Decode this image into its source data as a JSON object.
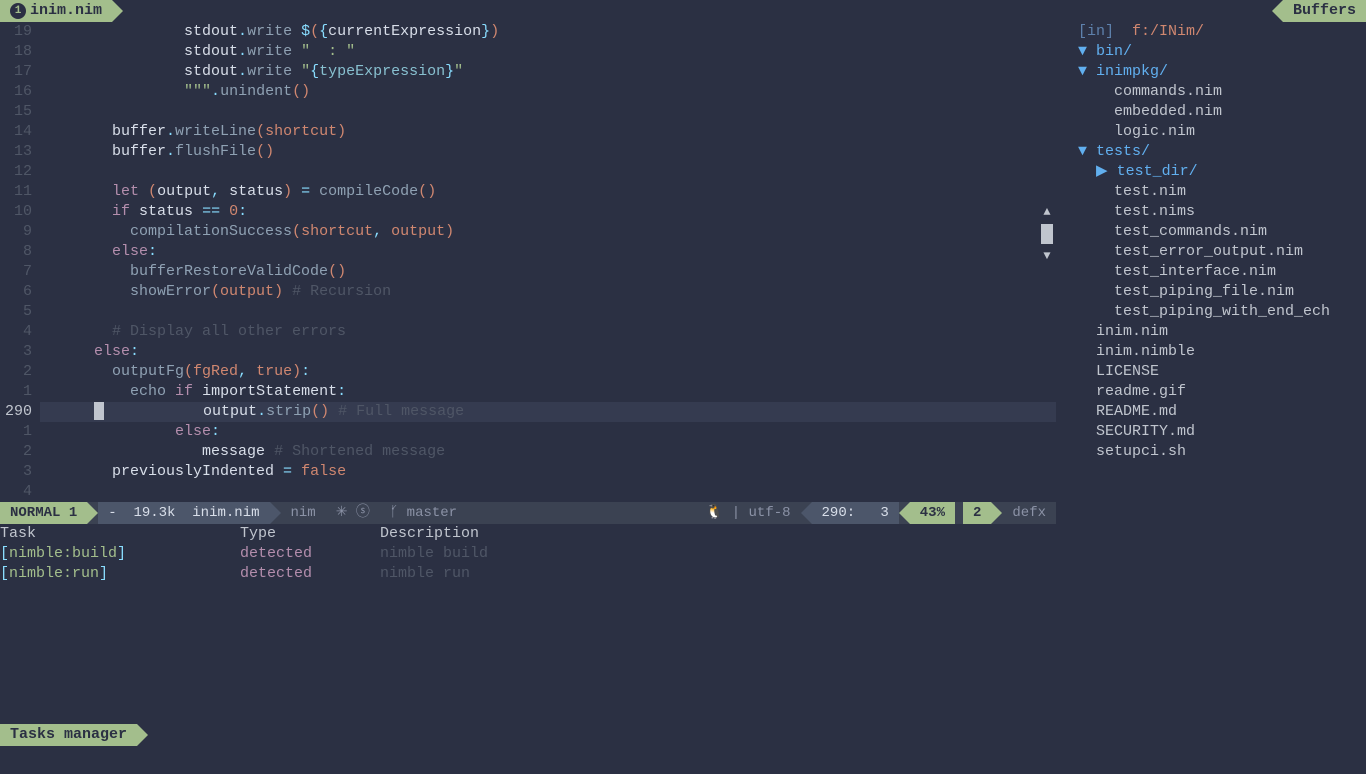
{
  "tabs": {
    "left_num": "1",
    "left_label": "inim.nim",
    "right_label": "Buffers"
  },
  "gutter": [
    "19",
    "18",
    "17",
    "16",
    "15",
    "14",
    "13",
    "12",
    "11",
    "10",
    "9",
    "8",
    "7",
    "6",
    "5",
    "4",
    "3",
    "2",
    "1",
    "290",
    "1",
    "2",
    "3",
    "4"
  ],
  "code": {
    "l19": {
      "pre": "                ",
      "fn1": "stdout",
      "dot": ".",
      "fn2": "write",
      "sp": " ",
      "dollar": "$",
      "lp": "(",
      "lb": "{",
      "id": "currentExpression",
      "rb": "}",
      "rp": ")"
    },
    "l18": {
      "pre": "                ",
      "fn1": "stdout",
      "dot": ".",
      "fn2": "write",
      "sp": " ",
      "str": "\"  : \""
    },
    "l17": {
      "pre": "                ",
      "fn1": "stdout",
      "dot": ".",
      "fn2": "write",
      "sp": " ",
      "q1": "\"",
      "lb": "{",
      "id": "typeExpression",
      "rb": "}",
      "q2": "\""
    },
    "l16": {
      "pre": "                ",
      "tq": "\"\"\"",
      "dot": ".",
      "fn": "unindent",
      "lp": "(",
      "rp": ")"
    },
    "l14": {
      "pre": "        ",
      "id": "buffer",
      "dot": ".",
      "fn": "writeLine",
      "lp": "(",
      "arg": "shortcut",
      "rp": ")"
    },
    "l13": {
      "pre": "        ",
      "id": "buffer",
      "dot": ".",
      "fn": "flushFile",
      "lp": "(",
      "rp": ")"
    },
    "l11": {
      "pre": "        ",
      "let": "let",
      "sp": " ",
      "lp": "(",
      "a": "output",
      "comma": ", ",
      "b": "status",
      "rp": ")",
      "eq": " = ",
      "fn": "compileCode",
      "lp2": "(",
      "rp2": ")"
    },
    "l10": {
      "pre": "        ",
      "if": "if",
      "sp": " ",
      "id": "status",
      "op": " == ",
      "num": "0",
      "colon": ":"
    },
    "l9": {
      "pre": "          ",
      "fn": "compilationSuccess",
      "lp": "(",
      "a": "shortcut",
      "comma": ", ",
      "b": "output",
      "rp": ")"
    },
    "l8": {
      "pre": "        ",
      "else": "else",
      "colon": ":"
    },
    "l7": {
      "pre": "          ",
      "fn": "bufferRestoreValidCode",
      "lp": "(",
      "rp": ")"
    },
    "l6": {
      "pre": "          ",
      "fn": "showError",
      "lp": "(",
      "arg": "output",
      "rp": ")",
      "sp": " ",
      "com": "# Recursion"
    },
    "l4": {
      "pre": "        ",
      "com": "# Display all other errors"
    },
    "l3": {
      "pre": "      ",
      "else": "else",
      "colon": ":"
    },
    "l2": {
      "pre": "        ",
      "fn": "outputFg",
      "lp": "(",
      "a": "fgRed",
      "comma": ", ",
      "b": "true",
      "rp": ")",
      "colon": ":"
    },
    "l1": {
      "pre": "          ",
      "echo": "echo",
      "sp": " ",
      "if": "if",
      "sp2": " ",
      "id": "importStatement",
      "colon": ":"
    },
    "l290": {
      "pre": "                  ",
      "id": "output",
      "dot": ".",
      "fn": "strip",
      "lp": "(",
      "rp": ")",
      "sp": " ",
      "com": "# Full message"
    },
    "p1": {
      "pre": "               ",
      "else": "else",
      "colon": ":"
    },
    "p2": {
      "pre": "                  ",
      "id": "message",
      "sp": " ",
      "com": "# Shortened message"
    },
    "p3": {
      "pre": "        ",
      "id": "previouslyIndented",
      "eq": " = ",
      "val": "false"
    }
  },
  "status": {
    "mode": "NORMAL",
    "win": "1",
    "dash": "-",
    "size": "19.3k",
    "file": "inim.nim",
    "ft": "nim",
    "diag": "✳ ⓢ",
    "branch_icon": "ᚶ",
    "branch": "master",
    "os_icon": "🐧",
    "pipe": "|",
    "enc": "utf-8",
    "line": "290:",
    "col": "3",
    "pct": "43%",
    "win2": "2",
    "buf2": "defx"
  },
  "tasks": {
    "headers": {
      "task": "Task",
      "type": "Type",
      "desc": "Description"
    },
    "rows": [
      {
        "name": "nimble:build",
        "type": "detected",
        "desc": "nimble build"
      },
      {
        "name": "nimble:run",
        "type": "detected",
        "desc": "nimble run"
      }
    ],
    "tab_label": "Tasks manager"
  },
  "tree": {
    "root_in": "[in]",
    "root_path": "f:/INim/",
    "items": [
      {
        "ind": 1,
        "arrow": "▼",
        "name": "bin/",
        "dir": true
      },
      {
        "ind": 1,
        "arrow": "▼",
        "name": "inimpkg/",
        "dir": true
      },
      {
        "ind": 2,
        "arrow": "",
        "name": "commands.nim"
      },
      {
        "ind": 2,
        "arrow": "",
        "name": "embedded.nim"
      },
      {
        "ind": 2,
        "arrow": "",
        "name": "logic.nim"
      },
      {
        "ind": 1,
        "arrow": "▼",
        "name": "tests/",
        "dir": true
      },
      {
        "ind": 2,
        "arrow": "▶",
        "name": "test_dir/",
        "dir": true
      },
      {
        "ind": 2,
        "arrow": "",
        "name": "test.nim"
      },
      {
        "ind": 2,
        "arrow": "",
        "name": "test.nims"
      },
      {
        "ind": 2,
        "arrow": "",
        "name": "test_commands.nim"
      },
      {
        "ind": 2,
        "arrow": "",
        "name": "test_error_output.nim"
      },
      {
        "ind": 2,
        "arrow": "",
        "name": "test_interface.nim"
      },
      {
        "ind": 2,
        "arrow": "",
        "name": "test_piping_file.nim"
      },
      {
        "ind": 2,
        "arrow": "",
        "name": "test_piping_with_end_ech"
      },
      {
        "ind": 1,
        "arrow": "",
        "name": "inim.nim"
      },
      {
        "ind": 1,
        "arrow": "",
        "name": "inim.nimble"
      },
      {
        "ind": 1,
        "arrow": "",
        "name": "LICENSE"
      },
      {
        "ind": 1,
        "arrow": "",
        "name": "readme.gif"
      },
      {
        "ind": 1,
        "arrow": "",
        "name": "README.md"
      },
      {
        "ind": 1,
        "arrow": "",
        "name": "SECURITY.md"
      },
      {
        "ind": 1,
        "arrow": "",
        "name": "setupci.sh"
      }
    ]
  }
}
